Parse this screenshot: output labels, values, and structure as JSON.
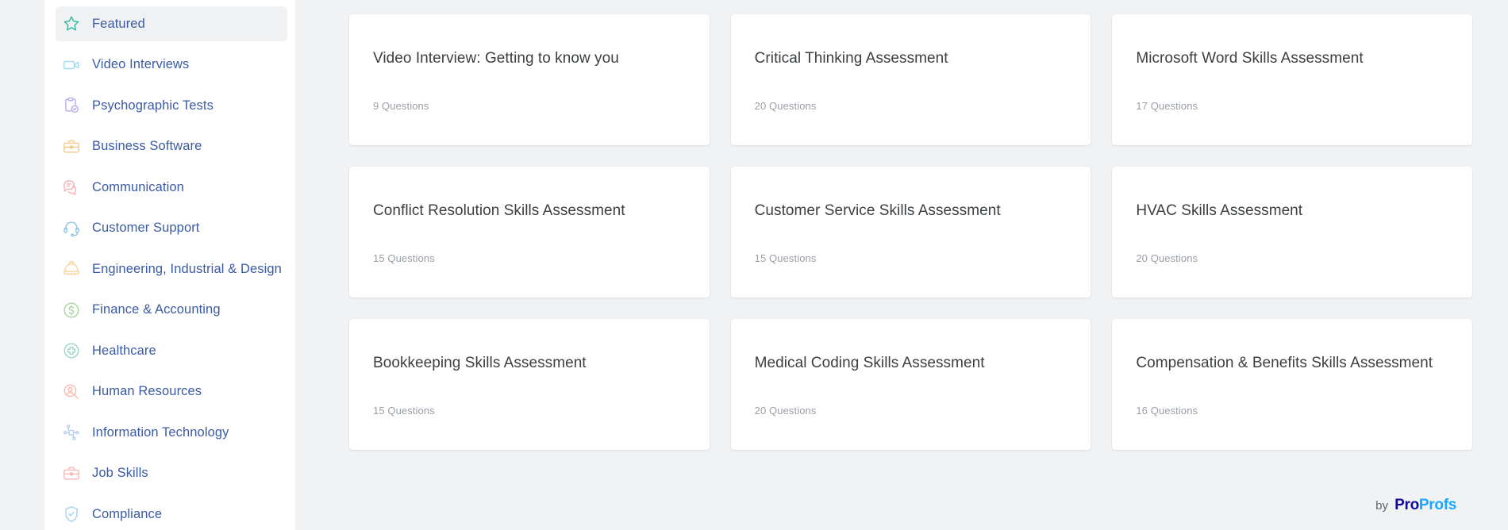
{
  "sidebar": {
    "items": [
      {
        "label": "Featured",
        "icon": "star-icon",
        "color": "#2eb8a4",
        "active": true
      },
      {
        "label": "Video Interviews",
        "icon": "video-camera-icon",
        "color": "#9fdcf0",
        "active": false
      },
      {
        "label": "Psychographic Tests",
        "icon": "clipboard-check-icon",
        "color": "#b3aef0",
        "active": false
      },
      {
        "label": "Business Software",
        "icon": "briefcase-icon",
        "color": "#f6c98b",
        "active": false
      },
      {
        "label": "Communication",
        "icon": "chat-bubbles-icon",
        "color": "#f9b0b8",
        "active": false
      },
      {
        "label": "Customer Support",
        "icon": "headset-icon",
        "color": "#8fc4e8",
        "active": false
      },
      {
        "label": "Engineering, Industrial & Design",
        "icon": "hard-hat-icon",
        "color": "#fbd49a",
        "active": false
      },
      {
        "label": "Finance & Accounting",
        "icon": "dollar-circle-icon",
        "color": "#a7d8a0",
        "active": false
      },
      {
        "label": "Healthcare",
        "icon": "medical-cross-icon",
        "color": "#9ad9c4",
        "active": false
      },
      {
        "label": "Human Resources",
        "icon": "person-search-icon",
        "color": "#fbb9ae",
        "active": false
      },
      {
        "label": "Information Technology",
        "icon": "network-nodes-icon",
        "color": "#b8cdec",
        "active": false
      },
      {
        "label": "Job Skills",
        "icon": "briefcase-icon",
        "color": "#f9b7b7",
        "active": false
      },
      {
        "label": "Compliance",
        "icon": "shield-check-icon",
        "color": "#9fd3ef",
        "active": false
      }
    ]
  },
  "main": {
    "cards": [
      {
        "title": "Video Interview: Getting to know you",
        "questions": "9 Questions"
      },
      {
        "title": "Critical Thinking Assessment",
        "questions": "20 Questions"
      },
      {
        "title": "Microsoft Word Skills Assessment",
        "questions": "17 Questions"
      },
      {
        "title": "Conflict Resolution Skills Assessment",
        "questions": "15 Questions"
      },
      {
        "title": "Customer Service Skills Assessment",
        "questions": "15 Questions"
      },
      {
        "title": "HVAC Skills Assessment",
        "questions": "20 Questions"
      },
      {
        "title": "Bookkeeping Skills Assessment",
        "questions": "15 Questions"
      },
      {
        "title": "Medical Coding Skills Assessment",
        "questions": "20 Questions"
      },
      {
        "title": "Compensation & Benefits Skills Assessment",
        "questions": "16 Questions"
      }
    ]
  },
  "footer": {
    "by_label": "by",
    "brand_first": "Pro",
    "brand_second": "Profs",
    "brand_first_color": "#140a9a",
    "brand_second_color": "#17a9fd"
  }
}
